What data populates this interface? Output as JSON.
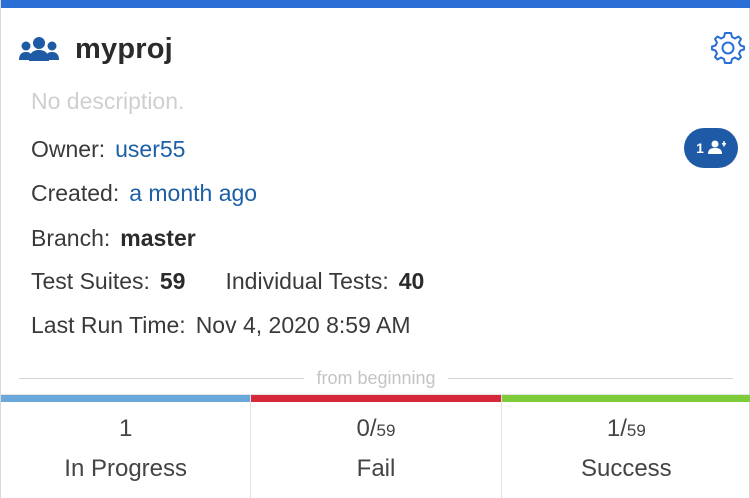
{
  "colors": {
    "accent": "#2a6fd6",
    "link": "#1b5fa8",
    "member_button": "#1e5aa5",
    "in_progress": "#6aa8dc",
    "fail": "#d5283a",
    "success": "#7fcc3a"
  },
  "project": {
    "name": "myproj",
    "description": "No description.",
    "icon": "team-icon",
    "settings_icon": "gear-icon"
  },
  "details": {
    "owner_label": "Owner:",
    "owner_value": "user55",
    "created_label": "Created:",
    "created_value": "a month ago",
    "branch_label": "Branch:",
    "branch_value": "master",
    "suites_label": "Test Suites:",
    "suites_value": "59",
    "individual_label": "Individual Tests:",
    "individual_value": "40",
    "last_run_label": "Last Run Time:",
    "last_run_value": "Nov 4, 2020 8:59 AM"
  },
  "members": {
    "count": "1",
    "icon": "add-user-icon"
  },
  "divider_text": "from beginning",
  "stats": [
    {
      "value": "1",
      "denominator": "",
      "label": "In Progress"
    },
    {
      "value": "0/",
      "denominator": "59",
      "label": "Fail"
    },
    {
      "value": "1/",
      "denominator": "59",
      "label": "Success"
    }
  ]
}
